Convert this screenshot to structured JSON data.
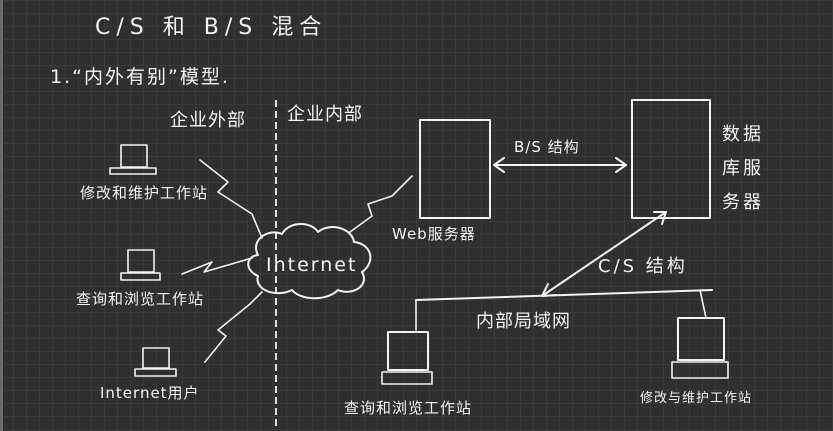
{
  "title": "C/S 和 B/S 混合",
  "subtitle": "1.“内外有别”模型.",
  "zones": {
    "outside": "企业外部",
    "inside": "企业内部"
  },
  "cloud_label": "Internet",
  "web_server_label": "Web服务器",
  "db_server_label": [
    "数据",
    "库服",
    "务器"
  ],
  "bs_label": "B/S 结构",
  "cs_label": "C/S 结构",
  "lan_label": "内部局域网",
  "external_workstations": [
    "修改和维护工作站",
    "查询和浏览工作站",
    "Internet用户"
  ],
  "internal_workstations": [
    "查询和浏览工作站",
    "修改与维护工作站"
  ],
  "colors": {
    "background": "#2f2f2f",
    "grid": "#3a3a3a",
    "ink": "#f2f2f2"
  }
}
